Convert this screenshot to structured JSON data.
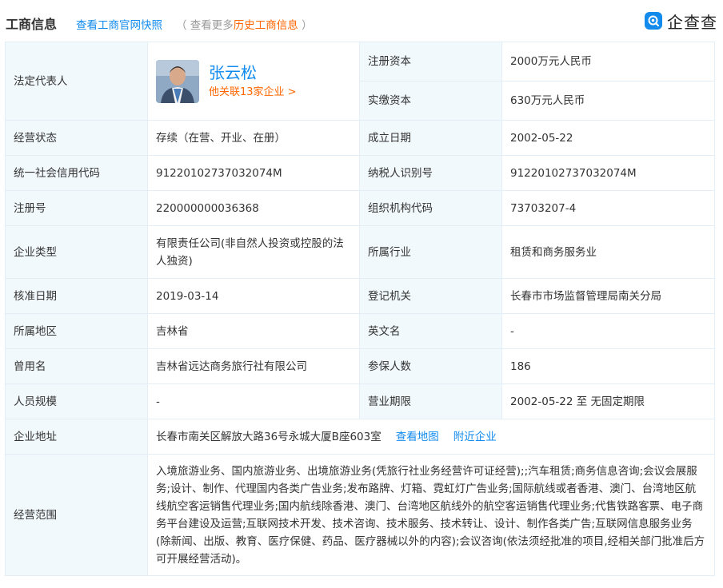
{
  "header": {
    "title": "工商信息",
    "snapshot_link": "查看工商官网快照",
    "history_prefix": "（ 查看更多",
    "history_link": "历史工商信息",
    "history_suffix": " ）",
    "logo_text": "企查查"
  },
  "legal_rep": {
    "label": "法定代表人",
    "name": "张云松",
    "related": "他关联13家企业 >"
  },
  "registered_capital": {
    "label": "注册资本",
    "value": "2000万元人民币"
  },
  "paid_capital": {
    "label": "实缴资本",
    "value": "630万元人民币"
  },
  "rows": [
    {
      "l1": "经营状态",
      "v1": "存续（在营、开业、在册）",
      "l2": "成立日期",
      "v2": "2002-05-22"
    },
    {
      "l1": "统一社会信用代码",
      "v1": "91220102737032074M",
      "l2": "纳税人识别号",
      "v2": "91220102737032074M"
    },
    {
      "l1": "注册号",
      "v1": "220000000036368",
      "l2": "组织机构代码",
      "v2": "73703207-4"
    },
    {
      "l1": "企业类型",
      "v1": "有限责任公司(非自然人投资或控股的法人独资)",
      "l2": "所属行业",
      "v2": "租赁和商务服务业"
    },
    {
      "l1": "核准日期",
      "v1": "2019-03-14",
      "l2": "登记机关",
      "v2": "长春市市场监督管理局南关分局"
    },
    {
      "l1": "所属地区",
      "v1": "吉林省",
      "l2": "英文名",
      "v2": "-"
    },
    {
      "l1": "曾用名",
      "v1": "吉林省远达商务旅行社有限公司",
      "l2": "参保人数",
      "v2": "186"
    },
    {
      "l1": "人员规模",
      "v1": "-",
      "l2": "营业期限",
      "v2": "2002-05-22 至 无固定期限"
    }
  ],
  "address": {
    "label": "企业地址",
    "value": "长春市南关区解放大路36号永城大厦B座603室",
    "map_link": "查看地图",
    "nearby_link": "附近企业"
  },
  "scope": {
    "label": "经营范围",
    "value": "入境旅游业务、国内旅游业务、出境旅游业务(凭旅行社业务经营许可证经营);;汽车租赁;商务信息咨询;会议会展服务;设计、制作、代理国内各类广告业务;发布路牌、灯箱、霓虹灯广告业务;国际航线或者香港、澳门、台湾地区航线航空客运销售代理业务;国内航线除香港、澳门、台湾地区航线外的航空客运销售代理业务;代售铁路客票、电子商务平台建设及运营;互联网技术开发、技术咨询、技术服务、技术转让、设计、制作各类广告;互联网信息服务业务(除新闻、出版、教育、医疗保健、药品、医疗器械以外的内容);会议咨询(依法须经批准的项目,经相关部门批准后方可开展经营活动)。"
  },
  "colors": {
    "link": "#128bed",
    "accent": "#ff6600",
    "label_bg": "#f2f9fc",
    "border": "#e4eef6"
  },
  "icons": {
    "logo": "qcc-logo-icon",
    "avatar": "person-photo"
  }
}
